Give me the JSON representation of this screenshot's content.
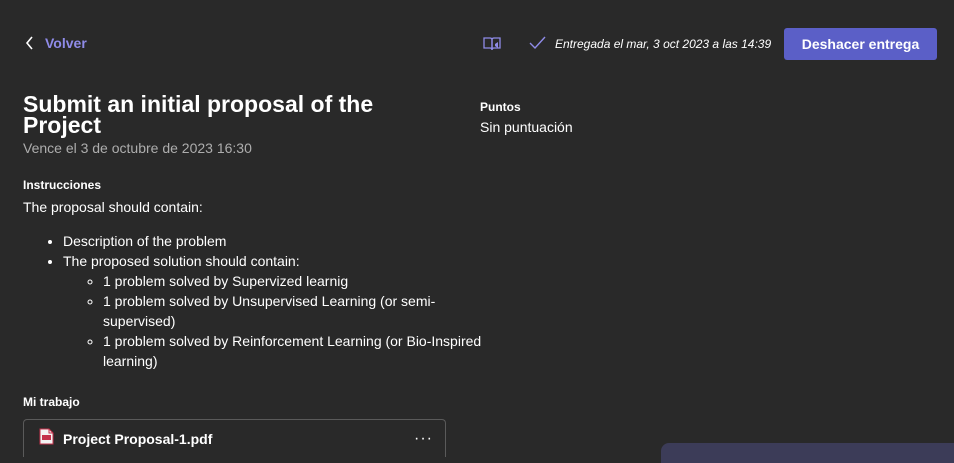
{
  "header": {
    "back_label": "Volver",
    "status_text": "Entregada el mar, 3 oct 2023 a las 14:39",
    "undo_button_label": "Deshacer entrega"
  },
  "assignment": {
    "title": "Submit an initial proposal of the Project",
    "due": "Vence el 3 de octubre de 2023 16:30",
    "instructions_label": "Instrucciones",
    "intro": "The proposal should contain:",
    "bullets": [
      "Description of the problem",
      "The proposed solution should contain:"
    ],
    "sub_bullets": [
      "1 problem solved by Supervized learnig",
      "1 problem solved by Unsupervised Learning (or semi-supervised)",
      "1 problem solved by Reinforcement Learning (or Bio-Inspired learning)"
    ]
  },
  "my_work": {
    "label": "Mi trabajo",
    "file_name": "Project Proposal-1.pdf",
    "more_icon": "more-horizontal-icon"
  },
  "points": {
    "label": "Puntos",
    "value": "Sin puntuación"
  },
  "icons": {
    "back": "chevron-left-icon",
    "reader": "immersive-reader-icon",
    "status": "checkmark-icon",
    "file": "pdf-file-icon"
  },
  "colors": {
    "background": "#292929",
    "accent": "#5b5fc7",
    "link": "#8f8be8",
    "muted_text": "#adadad"
  }
}
